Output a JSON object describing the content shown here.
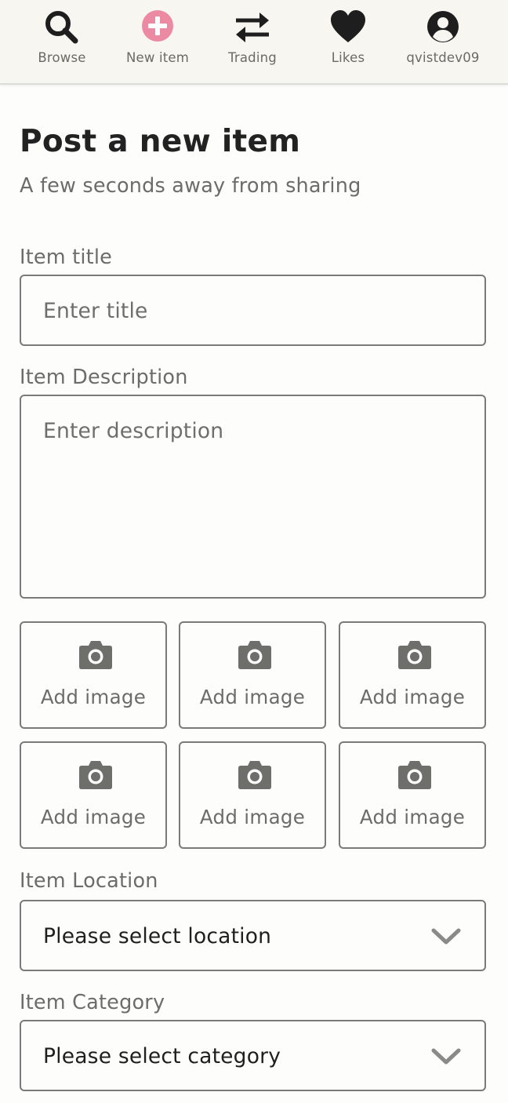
{
  "nav": {
    "items": [
      {
        "label": "Browse",
        "icon": "search-icon"
      },
      {
        "label": "New item",
        "icon": "plus-circle-icon"
      },
      {
        "label": "Trading",
        "icon": "swap-arrows-icon"
      },
      {
        "label": "Likes",
        "icon": "heart-icon"
      },
      {
        "label": "qvistdev09",
        "icon": "user-icon"
      }
    ],
    "active_color": "#ec8aa4"
  },
  "page": {
    "title": "Post a new item",
    "subtitle": "A few seconds away from sharing"
  },
  "form": {
    "title_label": "Item title",
    "title_placeholder": "Enter title",
    "title_value": "",
    "description_label": "Item Description",
    "description_placeholder": "Enter description",
    "description_value": "",
    "image_tiles": [
      {
        "label": "Add image",
        "icon": "camera-icon"
      },
      {
        "label": "Add image",
        "icon": "camera-icon"
      },
      {
        "label": "Add image",
        "icon": "camera-icon"
      },
      {
        "label": "Add image",
        "icon": "camera-icon"
      },
      {
        "label": "Add image",
        "icon": "camera-icon"
      },
      {
        "label": "Add image",
        "icon": "camera-icon"
      }
    ],
    "location_label": "Item Location",
    "location_value": "Please select location",
    "category_label": "Item Category",
    "category_value": "Please select category"
  }
}
